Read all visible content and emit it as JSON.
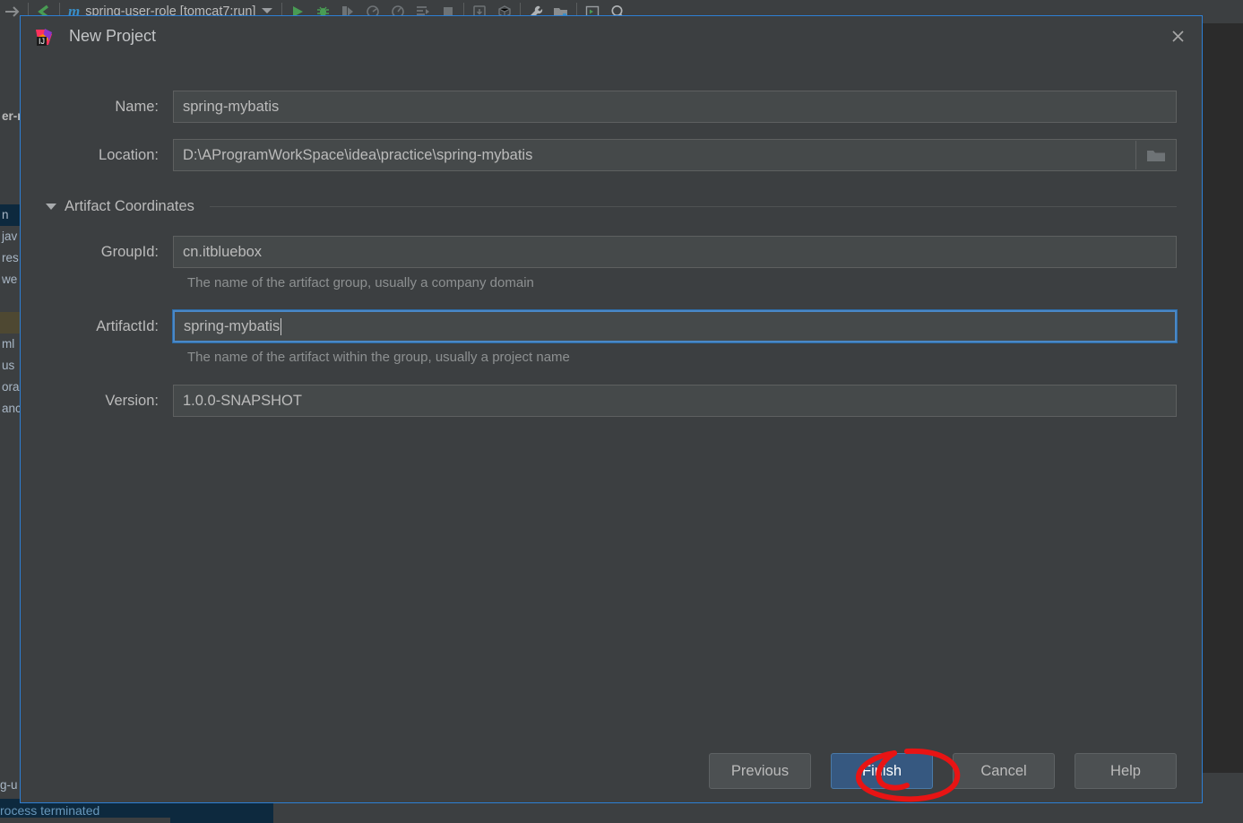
{
  "ide": {
    "toolbar": {
      "forward_icon": "arrow-right-icon",
      "back_icon": "chevron-left-icon",
      "maven_icon": "maven-m-icon",
      "run_config": "spring-user-role [tomcat7:run]",
      "dropdown_icon": "chevron-down-icon",
      "icons": [
        "run-icon",
        "debug-icon",
        "run-coverage-icon",
        "profile-icon",
        "profile-cpu-icon",
        "run-with-args-icon",
        "stop-icon",
        "update-app-icon",
        "build-artifacts-icon",
        "settings-wrench-icon",
        "project-structure-icon",
        "run-anything-icon",
        "search-icon"
      ]
    },
    "tree": [
      {
        "text": "er-r",
        "style": "bold"
      },
      {
        "text": "",
        "style": ""
      },
      {
        "text": "n",
        "style": "sel"
      },
      {
        "text": "jav",
        "style": ""
      },
      {
        "text": "res",
        "style": ""
      },
      {
        "text": "we",
        "style": ""
      },
      {
        "text": "",
        "style": ""
      },
      {
        "text": "",
        "style": "hl"
      },
      {
        "text": "ml",
        "style": ""
      },
      {
        "text": "us",
        "style": ""
      },
      {
        "text": "ora",
        "style": ""
      },
      {
        "text": "anc",
        "style": ""
      }
    ],
    "console": {
      "tab_label": "g-u",
      "status_text": "rocess terminated"
    }
  },
  "dialog": {
    "logo_icon": "intellij-idea-icon",
    "title": "New Project",
    "close_icon": "close-icon",
    "fields": {
      "name": {
        "label": "Name:",
        "value": "spring-mybatis",
        "placeholder": ""
      },
      "location": {
        "label": "Location:",
        "value": "D:\\AProgramWorkSpace\\idea\\practice\\spring-mybatis",
        "placeholder": "",
        "browse_icon": "folder-icon"
      },
      "group_id": {
        "label": "GroupId:",
        "value": "cn.itbluebox",
        "placeholder": "",
        "hint": "The name of the artifact group, usually a company domain"
      },
      "artifact_id": {
        "label": "ArtifactId:",
        "value": "spring-mybatis",
        "placeholder": "",
        "hint": "The name of the artifact within the group, usually a project name",
        "focused": true
      },
      "version": {
        "label": "Version:",
        "value": "1.0.0-SNAPSHOT",
        "placeholder": ""
      }
    },
    "section": {
      "title": "Artifact Coordinates",
      "expanded": true,
      "toggle_icon": "triangle-down-icon"
    },
    "buttons": {
      "previous": "Previous",
      "finish": "Finish",
      "cancel": "Cancel",
      "help": "Help"
    }
  },
  "annotation": {
    "shape": "red-ellipse-highlight",
    "color": "#e81414",
    "target": "Finish"
  },
  "colors": {
    "dialog_bg": "#3c3f41",
    "input_bg": "#45494a",
    "accent_blue": "#2d7fd4",
    "primary_button": "#365880",
    "focus_border": "#4a88c7",
    "editor_bg": "#2b2b2b",
    "annotation_red": "#e81414"
  }
}
